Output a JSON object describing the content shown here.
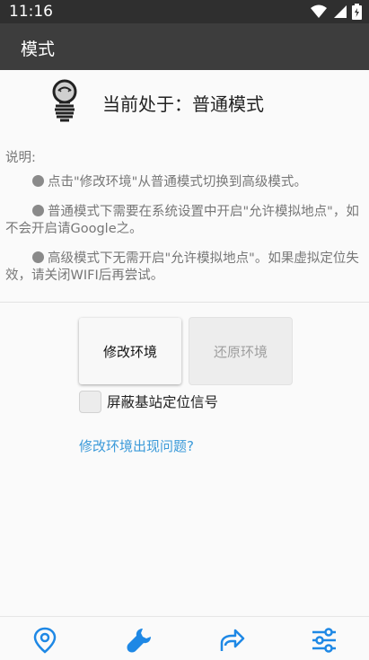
{
  "status_bar": {
    "time": "11:16",
    "icons": [
      "wifi-icon",
      "signal-icon",
      "battery-icon"
    ]
  },
  "app_bar": {
    "title": "模式"
  },
  "current_mode": {
    "text": "当前处于：普通模式",
    "icon": "lightbulb-icon"
  },
  "description": {
    "label": "说明:",
    "items": [
      "点击\"修改环境\"从普通模式切换到高级模式。",
      "普通模式下需要在系统设置中开启\"允许模拟地点\"，如不会开启请Google之。",
      "高级模式下无需开启\"允许模拟地点\"。如果虚拟定位失效，请关闭WIFI后再尝试。"
    ]
  },
  "actions": {
    "modify_label": "修改环境",
    "restore_label": "还原环境"
  },
  "block_cell": {
    "label": "屏蔽基站定位信号",
    "checked": false
  },
  "help_link": "修改环境出现问题?",
  "bottom_nav": [
    {
      "icon": "location-pin-icon",
      "active": false
    },
    {
      "icon": "wrench-icon",
      "active": true
    },
    {
      "icon": "share-arrow-icon",
      "active": false
    },
    {
      "icon": "sliders-icon",
      "active": false
    }
  ],
  "colors": {
    "status_bar": "#2f2f2f",
    "app_bar": "#3d3d3d",
    "accent": "#1e88e5",
    "link": "#3b9ad9"
  }
}
